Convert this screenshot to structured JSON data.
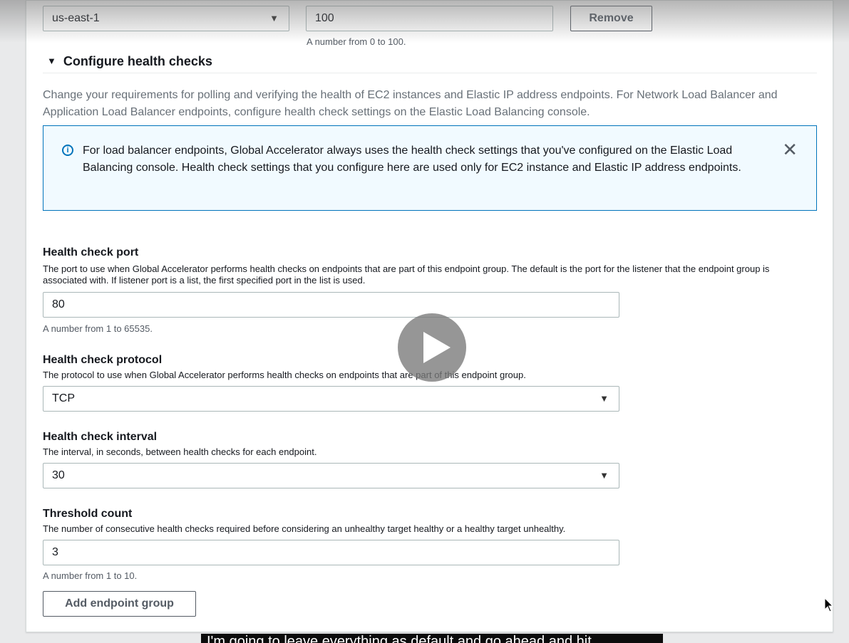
{
  "traffic_row": {
    "region_value": "us-east-1",
    "traffic_dial_value": "100",
    "traffic_dial_hint": "A number from 0 to 100.",
    "remove_label": "Remove"
  },
  "health_section": {
    "title": "Configure health checks",
    "description": "Change your requirements for polling and verifying the health of EC2 instances and Elastic IP address endpoints. For Network Load Balancer and Application Load Balancer endpoints, configure health check settings on the Elastic Load Balancing console.",
    "info": {
      "icon": "info-icon",
      "text": "For load balancer endpoints, Global Accelerator always uses the health check settings that you've configured on the Elastic Load Balancing console. Health check settings that you configure here are used only for EC2 instance and Elastic IP address endpoints."
    }
  },
  "fields": {
    "port": {
      "label": "Health check port",
      "description": "The port to use when Global Accelerator performs health checks on endpoints that are part of this endpoint group. The default is the port for the listener that the endpoint group is associated with. If listener port is a list, the first specified port in the list is used.",
      "value": "80",
      "hint": "A number from 1 to 65535."
    },
    "protocol": {
      "label": "Health check protocol",
      "description": "The protocol to use when Global Accelerator performs health checks on endpoints that are part of this endpoint group.",
      "value": "TCP"
    },
    "interval": {
      "label": "Health check interval",
      "description": "The interval, in seconds, between health checks for each endpoint.",
      "value": "30"
    },
    "threshold": {
      "label": "Threshold count",
      "description": "The number of consecutive health checks required before considering an unhealthy target healthy or a healthy target unhealthy.",
      "value": "3",
      "hint": "A number from 1 to 10."
    }
  },
  "add_endpoint_group_label": "Add endpoint group",
  "video_caption": "I'm going to leave everything as default and go ahead and hit",
  "colors": {
    "info_border": "#0073bb",
    "info_background": "#f1faff"
  }
}
